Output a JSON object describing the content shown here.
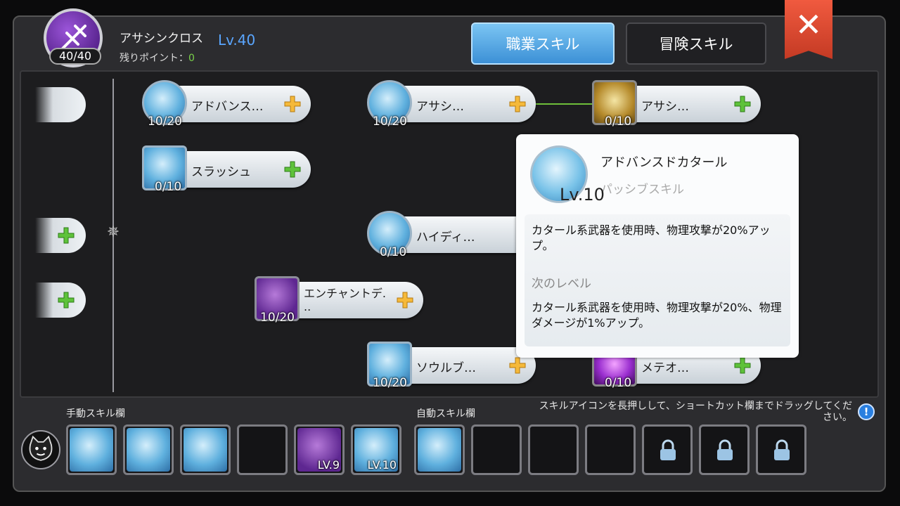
{
  "header": {
    "job_name": "アサシンクロス",
    "job_level": "Lv.40",
    "points_pill": "40/40",
    "remaining_label": "残りポイント：",
    "remaining_value": "0"
  },
  "tabs": [
    {
      "label": "職業スキル",
      "active": true
    },
    {
      "label": "冒険スキル",
      "active": false
    }
  ],
  "close_label": "✕",
  "skills": [
    {
      "name": "アドバンス…",
      "level": "10/20"
    },
    {
      "name": "スラッシュ",
      "level": "0/10"
    },
    {
      "name": "アサシ…",
      "level": "10/20"
    },
    {
      "name": "アサシ…",
      "level": "0/10"
    },
    {
      "name": "ハイディ…",
      "level": "0/10"
    },
    {
      "name": "エンチャントデ.\n..",
      "level": "10/20"
    },
    {
      "name": "ソウルブ…",
      "level": "10/20"
    },
    {
      "name": "メテオ…",
      "level": "0/10"
    }
  ],
  "tooltip": {
    "title": "アドバンスドカタール",
    "level": "Lv.10",
    "type": "パッシブスキル",
    "description": "カタール系武器を使用時、物理攻撃が20%アップ。",
    "next_heading": "次のレベル",
    "next_description": "カタール系武器を使用時、物理攻撃が20%、物理ダメージが1%アップ。"
  },
  "bottom": {
    "manual_label": "手動スキル欄",
    "auto_label": "自動スキル欄",
    "hint": "スキルアイコンを長押しして、ショートカット欄までドラッグしてください。",
    "info": "!",
    "manual_slot_levels": [
      "",
      "",
      "",
      "",
      "LV.9",
      "LV.10"
    ]
  },
  "colors": {
    "accent_blue": "#3c90d6",
    "close_red": "#d9452e",
    "plus_yellow": "#f5b93a",
    "plus_green": "#5ec23a",
    "remaining_green": "#7ad24a"
  }
}
